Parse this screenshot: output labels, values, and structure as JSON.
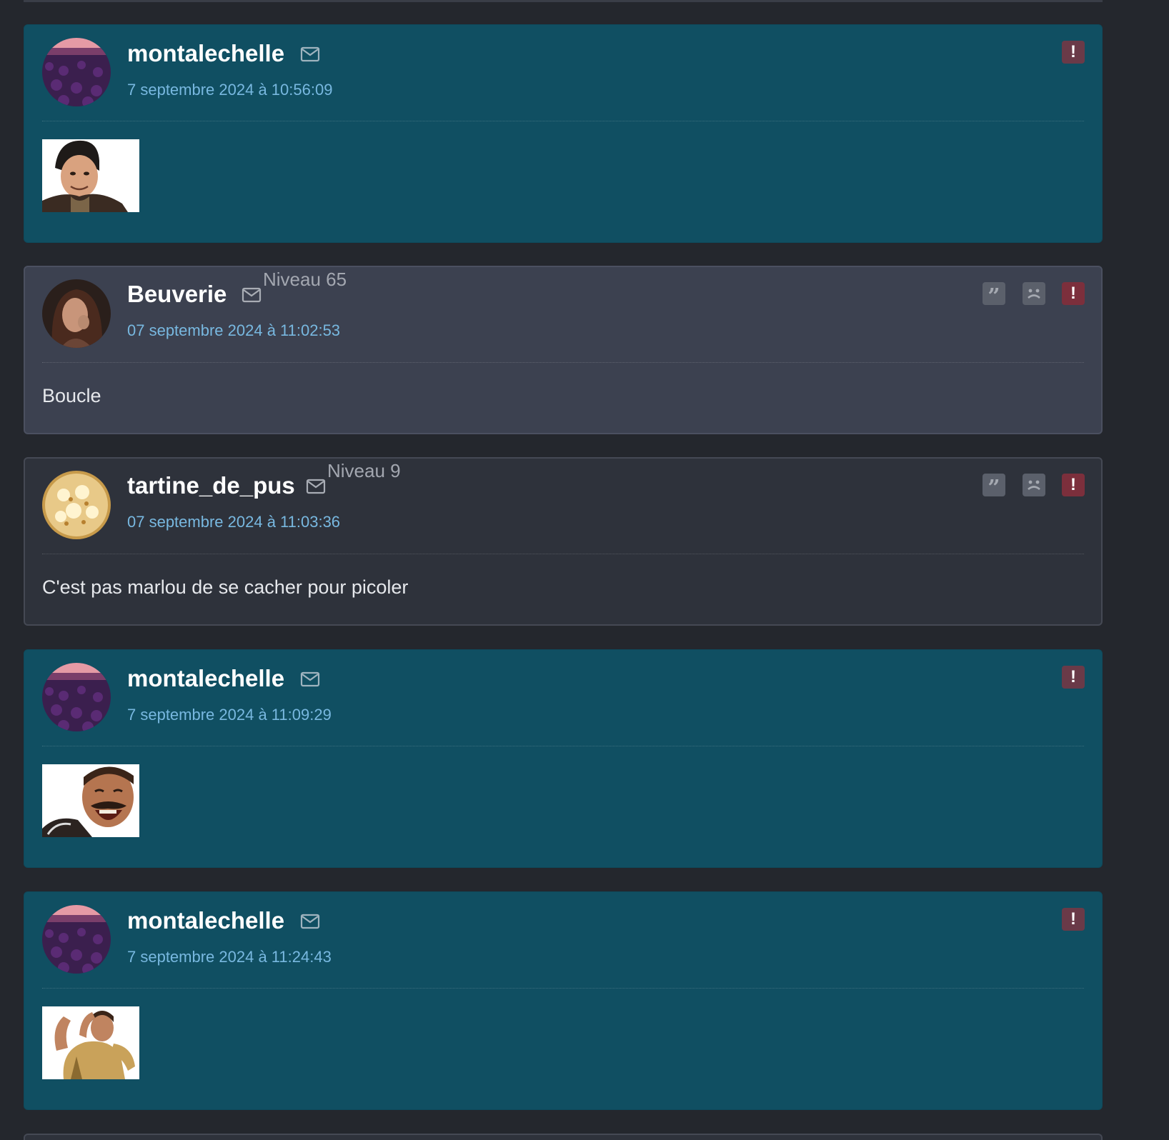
{
  "posts": [
    {
      "author": "montalechelle",
      "date": "7 septembre 2024 à 10:56:09",
      "level": "",
      "text": "",
      "sticker": "risitas-sticker-smirk",
      "actions": [
        "report-icon"
      ]
    },
    {
      "author": "Beuverie",
      "date": "07 septembre 2024 à 11:02:53",
      "level": "Niveau 65",
      "text": "Boucle",
      "sticker": "",
      "actions": [
        "quote-icon",
        "sad-face-icon",
        "report-icon"
      ]
    },
    {
      "author": "tartine_de_pus",
      "date": "07 septembre 2024 à 11:03:36",
      "level": "Niveau 9",
      "text": "C'est pas marlou de se cacher pour picoler",
      "sticker": "",
      "actions": [
        "quote-icon",
        "sad-face-icon",
        "report-icon"
      ]
    },
    {
      "author": "montalechelle",
      "date": "7 septembre 2024 à 11:09:29",
      "level": "",
      "text": "",
      "sticker": "risitas-sticker-laugh",
      "actions": [
        "report-icon"
      ]
    },
    {
      "author": "montalechelle",
      "date": "7 septembre 2024 à 11:24:43",
      "level": "",
      "text": "",
      "sticker": "risitas-sticker-dance",
      "actions": [
        "report-icon"
      ]
    }
  ],
  "icons": {
    "report": "!",
    "quote": "”",
    "mail": "mail-icon"
  },
  "colors": {
    "own_post_bg": "#104f62",
    "post_bg_alt": "#3c4150",
    "post_bg_dark": "#2e323b",
    "date_color": "#78b8e0",
    "report_red": "#7c2f3c"
  }
}
